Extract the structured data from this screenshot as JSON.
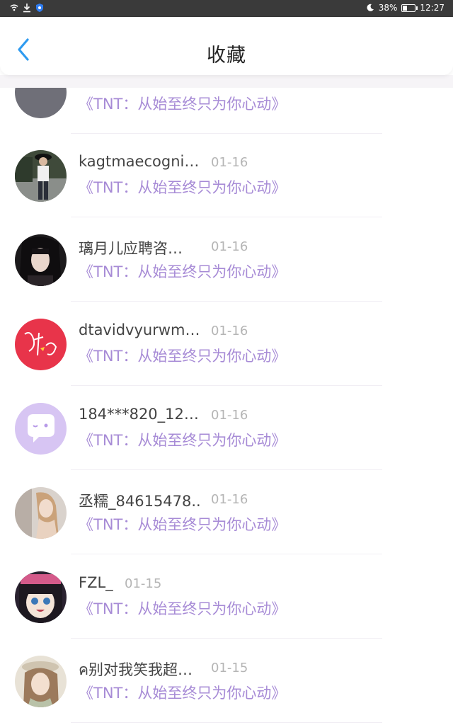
{
  "status_bar": {
    "battery": "38%",
    "time": "12:27"
  },
  "header": {
    "title": "收藏"
  },
  "items": [
    {
      "name": "",
      "date": "",
      "message": "《TNT：从始至终只为你心动》",
      "avatar": "gray-avatar"
    },
    {
      "name": "kagtmaecogni…",
      "date": "01-16",
      "message": "《TNT：从始至终只为你心动》",
      "avatar": "photo-avatar"
    },
    {
      "name": "璃月儿应聘咨…",
      "date": "01-16",
      "message": "《TNT：从始至终只为你心动》",
      "avatar": "photo-avatar"
    },
    {
      "name": "dtavidvyurwm…",
      "date": "01-16",
      "message": "《TNT：从始至终只为你心动》",
      "avatar": "red-signature-avatar"
    },
    {
      "name": "184***820_123..",
      "date": "01-16",
      "message": "《TNT：从始至终只为你心动》",
      "avatar": "chat-bubble-avatar"
    },
    {
      "name": "丞糯_84615478..",
      "date": "01-16",
      "message": "《TNT：从始至终只为你心动》",
      "avatar": "photo-avatar"
    },
    {
      "name": "FZL_",
      "date": "01-15",
      "message": "《TNT：从始至终只为你心动》",
      "avatar": "anime-avatar"
    },
    {
      "name": "ค别对我笑我超…",
      "date": "01-15",
      "message": "《TNT：从始至终只为你心动》",
      "avatar": "illustration-avatar"
    }
  ],
  "colors": {
    "accent": "#2f9bf0",
    "message": "#a78bd6",
    "date": "#b5b5b5"
  }
}
